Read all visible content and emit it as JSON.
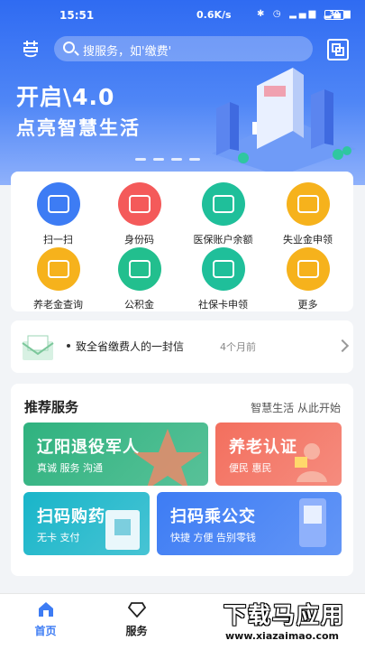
{
  "status_bar": {
    "time": "15:51",
    "speed": "0.6K/s",
    "battery": "30"
  },
  "header": {
    "search_placeholder": "搜服务，如'缴费'"
  },
  "banner": {
    "line1": "开启\\4.0",
    "line2": "点亮智慧生活"
  },
  "services": [
    {
      "label": "扫一扫",
      "color": "#3d7cf4",
      "icon": "scan-icon"
    },
    {
      "label": "身份码",
      "color": "#f45a5a",
      "icon": "qrcode-icon"
    },
    {
      "label": "医保账户余额",
      "color": "#1fbf9a",
      "icon": "card-icon"
    },
    {
      "label": "失业金申领",
      "color": "#f6b21c",
      "icon": "wallet-icon"
    },
    {
      "label": "养老金查询",
      "color": "#f6b21c",
      "icon": "elder-icon"
    },
    {
      "label": "公积金",
      "color": "#22bf8e",
      "icon": "house-icon"
    },
    {
      "label": "社保卡申领",
      "color": "#1fbf9a",
      "icon": "sicard-icon"
    },
    {
      "label": "更多",
      "color": "#f6b21c",
      "icon": "more-icon"
    }
  ],
  "notice": {
    "text": "致全省缴费人的一封信",
    "time": "4个月前"
  },
  "recommend": {
    "title": "推荐服务",
    "subtitle": "智慧生活 从此开始",
    "cards": [
      {
        "title": "辽阳退役军人",
        "sub": "真诚 服务 沟通",
        "color": "#2fb27f"
      },
      {
        "title": "养老认证",
        "sub": "便民 惠民",
        "color": "#f36f5e"
      },
      {
        "title": "扫码购药",
        "sub": "无卡 支付",
        "color": "#19b5c9"
      },
      {
        "title": "扫码乘公交",
        "sub": "快捷 方便 告别零钱",
        "color": "#3d7cf4"
      }
    ]
  },
  "tabbar": [
    {
      "label": "首页",
      "active": true
    },
    {
      "label": "服务",
      "active": false
    },
    {
      "label": "",
      "active": false
    },
    {
      "label": "",
      "active": false
    }
  ],
  "watermark": {
    "title": "下载马应用",
    "url": "www.xiazaimao.com"
  }
}
